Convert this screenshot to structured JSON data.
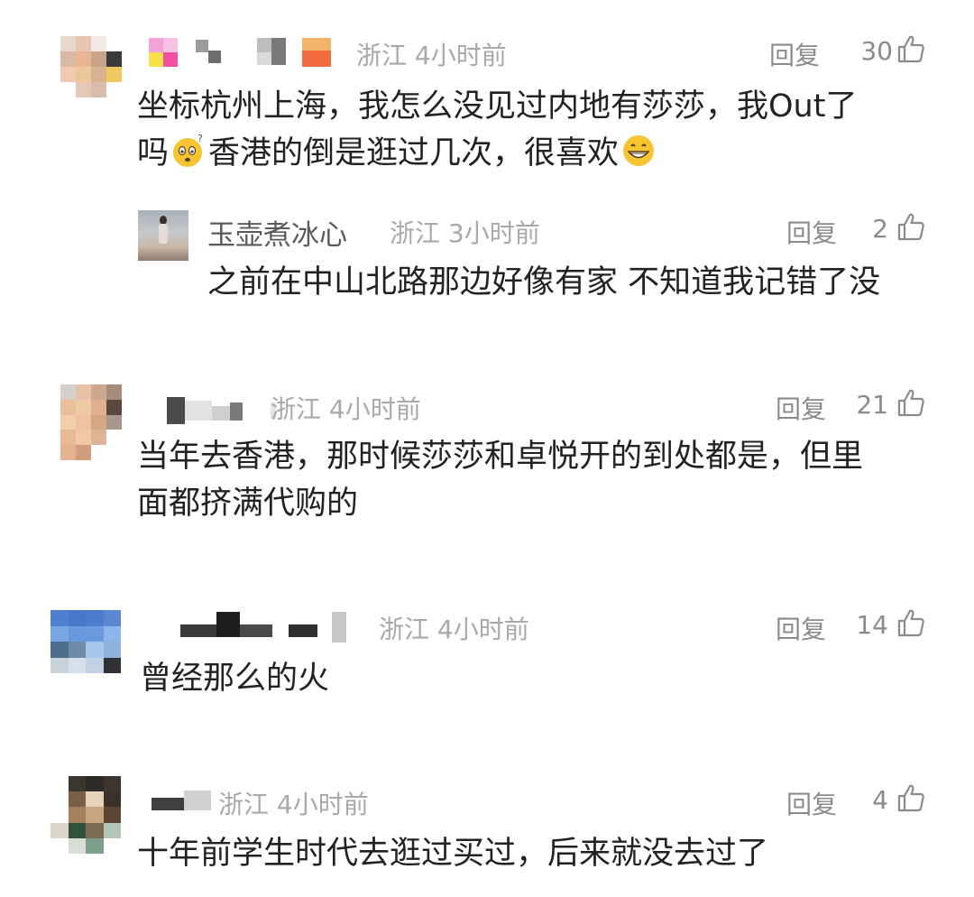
{
  "comments": [
    {
      "location_time": "浙江 4小时前",
      "location_visible": "浙江 4小时前",
      "reply_label": "回复",
      "likes": "30",
      "text_line1": "坐标杭州上海，我怎么没见过内地有莎莎，我Out了",
      "text_line2_part1": "吗",
      "emoji1": "thinking-face",
      "text_line2_part2": "香港的倒是逛过几次，很喜欢",
      "emoji2": "grinning-face"
    },
    {
      "username": "玉壶煮冰心",
      "location_time": "浙江 3小时前",
      "reply_label": "回复",
      "likes": "2",
      "text_line1": "之前在中山北路那边好像有家 不知道我记错了没"
    },
    {
      "location_time": "浙江 4小时前",
      "location_visible": "浙江 4小时前",
      "reply_label": "回复",
      "likes": "21",
      "text_line1": "当年去香港，那时候莎莎和卓悦开的到处都是，但里",
      "text_line2": "面都挤满代购的"
    },
    {
      "location_time": "浙江 4小时前",
      "reply_label": "回复",
      "likes": "14",
      "text_line1": "曾经那么的火"
    },
    {
      "location_time": "浙江 4小时前",
      "reply_label": "回复",
      "likes": "4",
      "text_line1": "十年前学生时代去逛过买过，后来就没去过了"
    }
  ],
  "colors": {
    "text": "#222222",
    "meta": "#a9a9a9",
    "action": "#8b8b8b",
    "username": "#5a5a5a"
  },
  "icons": [
    "thumbs-up-icon",
    "avatar",
    "thinking-face",
    "grinning-face"
  ]
}
